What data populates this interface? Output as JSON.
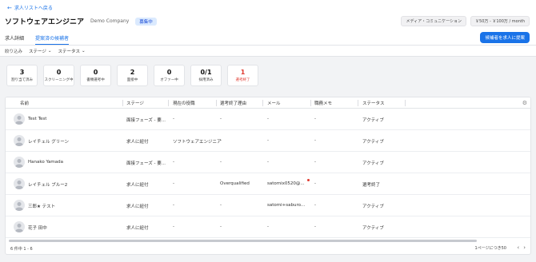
{
  "header": {
    "back_label": "求人リストへ戻る",
    "title": "ソフトウェアエンジニア",
    "company": "Demo Company",
    "status_badge": "募集中",
    "chips": [
      "メディア・コミュニケーション",
      "￥50万 - ￥100万 / month"
    ]
  },
  "tabs": [
    {
      "label": "求人詳細",
      "active": false
    },
    {
      "label": "提案済の候補者",
      "active": true
    }
  ],
  "propose_button": "候補者を求人に提案",
  "filters": {
    "label": "絞り込み",
    "stage": "ステージ",
    "status": "ステータス"
  },
  "stats": [
    {
      "value": "3",
      "label": "割り当て済み"
    },
    {
      "value": "0",
      "label": "スクリーニング中"
    },
    {
      "value": "0",
      "label": "書類選考中"
    },
    {
      "value": "2",
      "label": "面接中"
    },
    {
      "value": "0",
      "label": "オファー中"
    },
    {
      "value": "0/1",
      "label": "採用済み"
    },
    {
      "value": "1",
      "label": "選考終了",
      "accent": "#e0392f"
    }
  ],
  "table": {
    "columns": [
      "名前",
      "ステージ",
      "現在の役職",
      "選考終了理由",
      "メール",
      "職務メモ",
      "ステータス"
    ],
    "rows": [
      {
        "name": "Test Test",
        "stage": "面接フェーズ - 要...",
        "position": "-",
        "reason": "-",
        "email": "-",
        "memo": "-",
        "status": "アクティブ"
      },
      {
        "name": "レイチェル グリーン",
        "stage": "求人に紐付",
        "position": "ソフトウェアエンジニア",
        "reason": "-",
        "email": "-",
        "memo": "-",
        "status": "アクティブ"
      },
      {
        "name": "Hanako Yamada",
        "stage": "面接フェーズ - 要...",
        "position": "-",
        "reason": "-",
        "email": "-",
        "memo": "-",
        "status": "アクティブ"
      },
      {
        "name": "レイチェル ブルー2",
        "stage": "求人に紐付",
        "position": "-",
        "reason": "Overqualified",
        "email": "satomix0520@...",
        "memo": "-",
        "status": "選考終了"
      },
      {
        "name": "三郎★ テスト",
        "stage": "求人に紐付",
        "position": "-",
        "reason": "-",
        "email": "satomi+saburo...",
        "memo": "-",
        "status": "アクティブ"
      },
      {
        "name": "花子 田中",
        "stage": "求人に紐付",
        "position": "-",
        "reason": "-",
        "email": "-",
        "memo": "-",
        "status": "アクティブ"
      }
    ]
  },
  "footer": {
    "count": "6 件中 1 - 6",
    "per_page": "1ページにつき50"
  }
}
